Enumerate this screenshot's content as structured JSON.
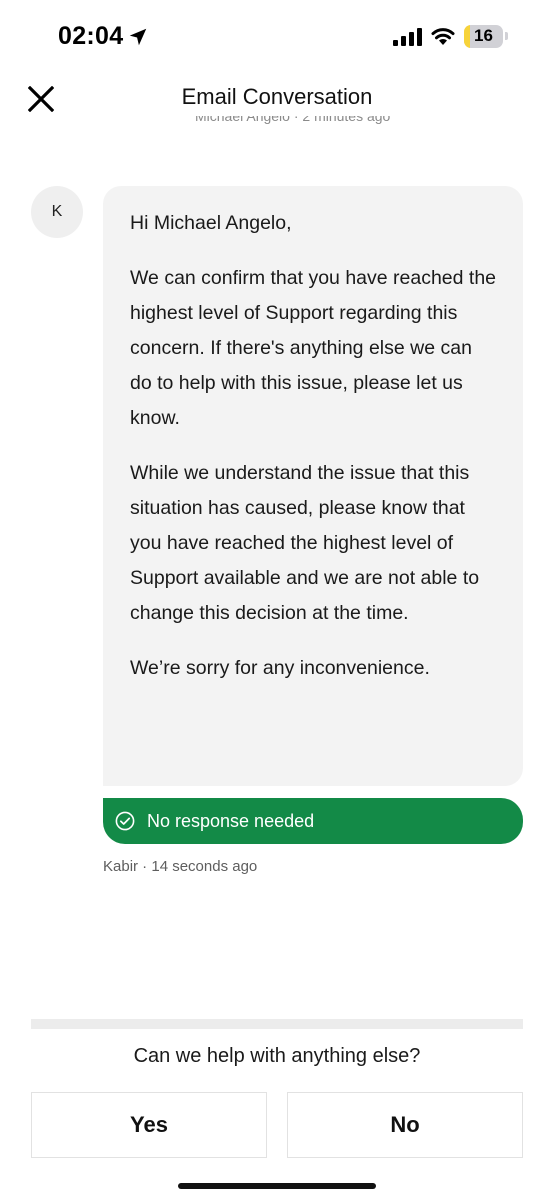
{
  "status_bar": {
    "time": "02:04",
    "battery_level": "16",
    "battery_fraction": 0.16,
    "battery_color": "#f7d33a"
  },
  "header": {
    "title": "Email Conversation",
    "close_icon": "close-icon"
  },
  "previous_message": {
    "meta": "Michael Angelo · 2 minutes ago"
  },
  "message": {
    "avatar_initial": "K",
    "paragraphs": [
      "Hi Michael Angelo,",
      "We can confirm that you have reached the highest level of Support regarding this concern. If there's anything else we can do to help with this issue, please let us know.",
      "While we understand the issue that this situation has caused, please know that you have reached the highest level of Support available and we are not able to change this decision at the time.",
      "We’re sorry for any inconvenience."
    ],
    "badge_text": "No response needed",
    "badge_icon": "check-circle-icon",
    "badge_color": "#138a47",
    "meta": "Kabir · 14 seconds ago"
  },
  "footer": {
    "question": "Can we help with anything else?",
    "yes_label": "Yes",
    "no_label": "No"
  }
}
